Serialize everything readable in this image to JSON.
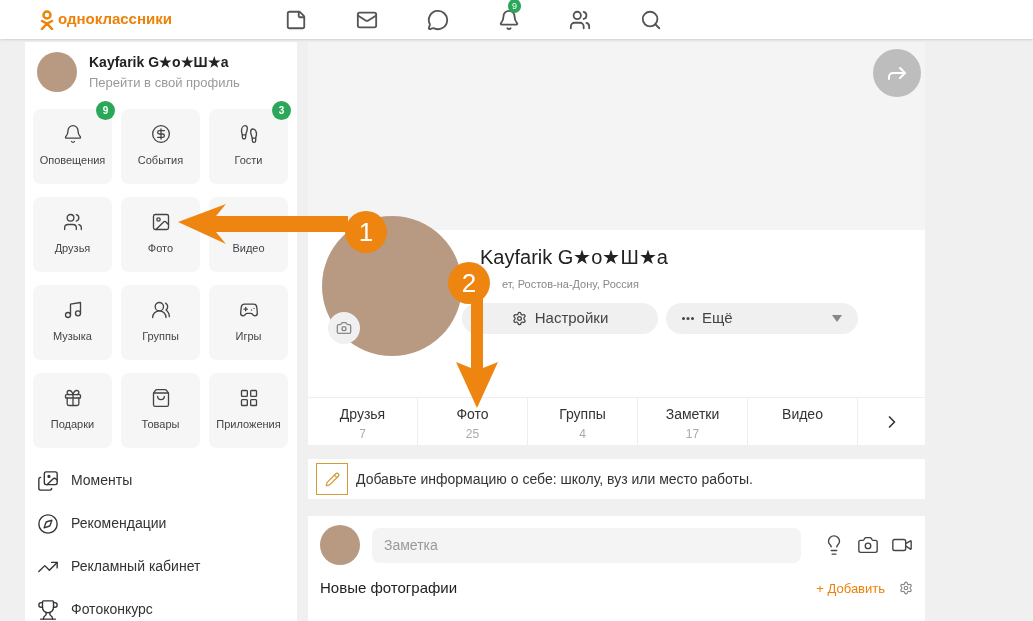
{
  "header": {
    "logo_text": "одноклассники",
    "bell_badge": "9"
  },
  "sidebar": {
    "profile": {
      "name": "Kayfarik G★o★Ш★a",
      "link": "Перейти в свой профиль"
    },
    "tiles": [
      {
        "label": "Оповещения",
        "badge": "9"
      },
      {
        "label": "События"
      },
      {
        "label": "Гости",
        "badge": "3"
      },
      {
        "label": "Друзья"
      },
      {
        "label": "Фото"
      },
      {
        "label": "Видео"
      },
      {
        "label": "Музыка"
      },
      {
        "label": "Группы"
      },
      {
        "label": "Игры"
      },
      {
        "label": "Подарки"
      },
      {
        "label": "Товары"
      },
      {
        "label": "Приложения"
      }
    ],
    "menu": [
      "Моменты",
      "Рекомендации",
      "Рекламный кабинет",
      "Фотоконкурс"
    ]
  },
  "profile": {
    "name": "Kayfarik G★o★Ш★a",
    "subtitle": "ет, Ростов-на-Дону, Россия",
    "settings_button": "Настройки",
    "more_button": "Ещё",
    "tabs": [
      {
        "label": "Друзья",
        "count": "7"
      },
      {
        "label": "Фото",
        "count": "25"
      },
      {
        "label": "Группы",
        "count": "4"
      },
      {
        "label": "Заметки",
        "count": "17"
      },
      {
        "label": "Видео"
      }
    ]
  },
  "info_prompt": "Добавьте информацию о себе: школу, вуз или место работы.",
  "post": {
    "placeholder": "Заметка",
    "section_title": "Новые фотографии",
    "add_link": "+ Добавить"
  },
  "annotations": [
    {
      "number": "1"
    },
    {
      "number": "2"
    }
  ]
}
